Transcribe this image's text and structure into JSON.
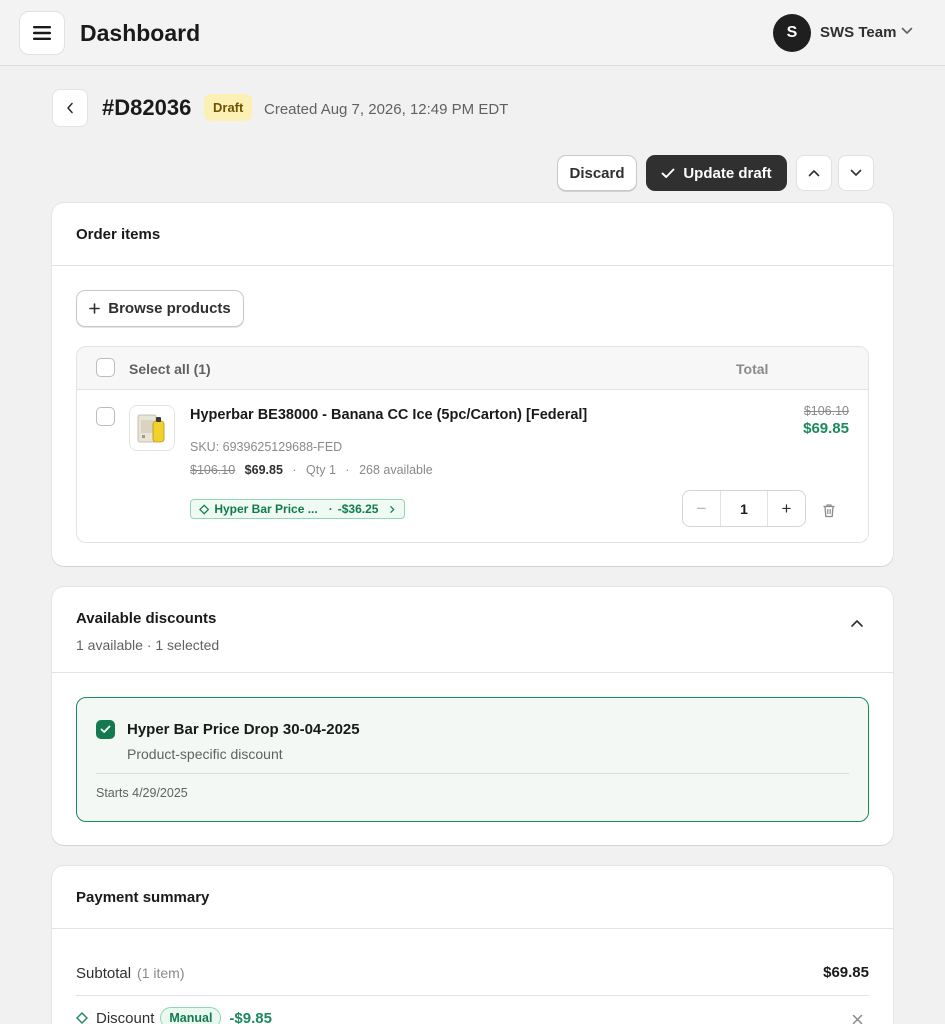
{
  "header": {
    "title": "Dashboard",
    "avatar_initial": "S",
    "team_name": "SWS Team"
  },
  "order": {
    "id": "#D82036",
    "status": "Draft",
    "created": "Created Aug 7, 2026, 12:49 PM EDT"
  },
  "actions": {
    "discard": "Discard",
    "update": "Update draft"
  },
  "order_items": {
    "title": "Order items",
    "browse_label": "Browse products",
    "select_all": "Select all (1)",
    "total_header": "Total",
    "items": [
      {
        "name": "Hyperbar BE38000 - Banana CC Ice (5pc/Carton) [Federal]",
        "sku": "SKU: 6939625129688-FED",
        "original_price": "$106.10",
        "price": "$69.85",
        "qty_text": "Qty 1",
        "availability": "268 available",
        "discount_label": "Hyper Bar Price ...",
        "discount_amount": "-$36.25",
        "quantity": "1",
        "total_original": "$106.10",
        "total": "$69.85"
      }
    ]
  },
  "discounts": {
    "title": "Available discounts",
    "subtitle": "1 available · 1 selected",
    "options": [
      {
        "name": "Hyper Bar Price Drop 30-04-2025",
        "type": "Product-specific discount",
        "starts": "Starts 4/29/2025",
        "selected": true
      }
    ]
  },
  "payment": {
    "title": "Payment summary",
    "subtotal_label": "Subtotal",
    "subtotal_count": "(1 item)",
    "subtotal_value": "$69.85",
    "discount_label": "Discount",
    "discount_badge": "Manual",
    "discount_value": "-$9.85"
  },
  "colors": {
    "accent_green": "#1c8a5e",
    "primary_dark": "#303030",
    "draft_badge_bg": "#fdf0b4"
  },
  "icons": [
    "menu-icon",
    "chevron-down-icon",
    "chevron-left-icon",
    "check-icon",
    "chevron-up-icon",
    "plus-icon",
    "trash-icon",
    "tag-icon",
    "chevron-right-icon",
    "close-icon"
  ]
}
